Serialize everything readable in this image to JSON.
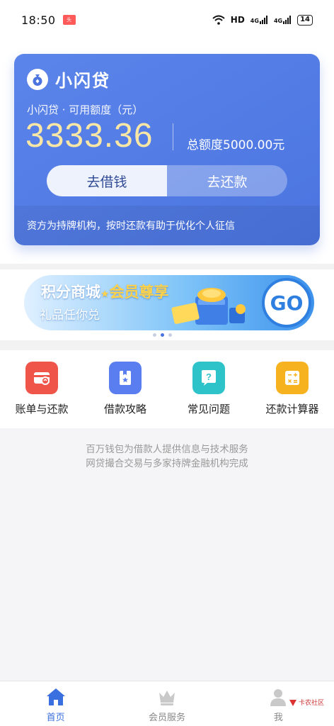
{
  "status_bar": {
    "time": "18:50",
    "network": "HD",
    "signal1": "4G",
    "signal2": "4G",
    "battery": "14"
  },
  "card": {
    "brand_name": "小闪贷",
    "limit_label": "小闪贷 · 可用额度（元）",
    "available_amount": "3333.36",
    "total_limit": "总额度5000.00元",
    "borrow_button": "去借钱",
    "repay_button": "去还款",
    "footer_note": "资方为持牌机构，按时还款有助于优化个人征信",
    "colors": {
      "card_bg": "#4b74e0",
      "amount": "#fbe7a5"
    }
  },
  "banner": {
    "title_part1": "积分商城",
    "star": "★",
    "title_part2": "会员尊享",
    "subtitle": "礼品任你兑",
    "go_label": "GO",
    "page_count": 3,
    "active_page": 2
  },
  "actions": [
    {
      "label": "账单与还款",
      "icon": "bill-icon",
      "color": "#f0554a"
    },
    {
      "label": "借款攻略",
      "icon": "guide-book-icon",
      "color": "#5a7ef0"
    },
    {
      "label": "常见问题",
      "icon": "question-icon",
      "color": "#2ec3c9"
    },
    {
      "label": "还款计算器",
      "icon": "calculator-icon",
      "color": "#f7b21f"
    }
  ],
  "disclaimer": {
    "line1": "百万钱包为借款人提供信息与技术服务",
    "line2": "网贷撮合交易与多家持牌金融机构完成"
  },
  "tabbar": {
    "tabs": [
      {
        "label": "首页",
        "icon": "home-icon",
        "active": true
      },
      {
        "label": "会员服务",
        "icon": "crown-icon",
        "active": false
      },
      {
        "label": "我",
        "icon": "user-icon",
        "active": false
      }
    ],
    "active_color": "#3a6fe0"
  },
  "watermark": "卡农社区"
}
